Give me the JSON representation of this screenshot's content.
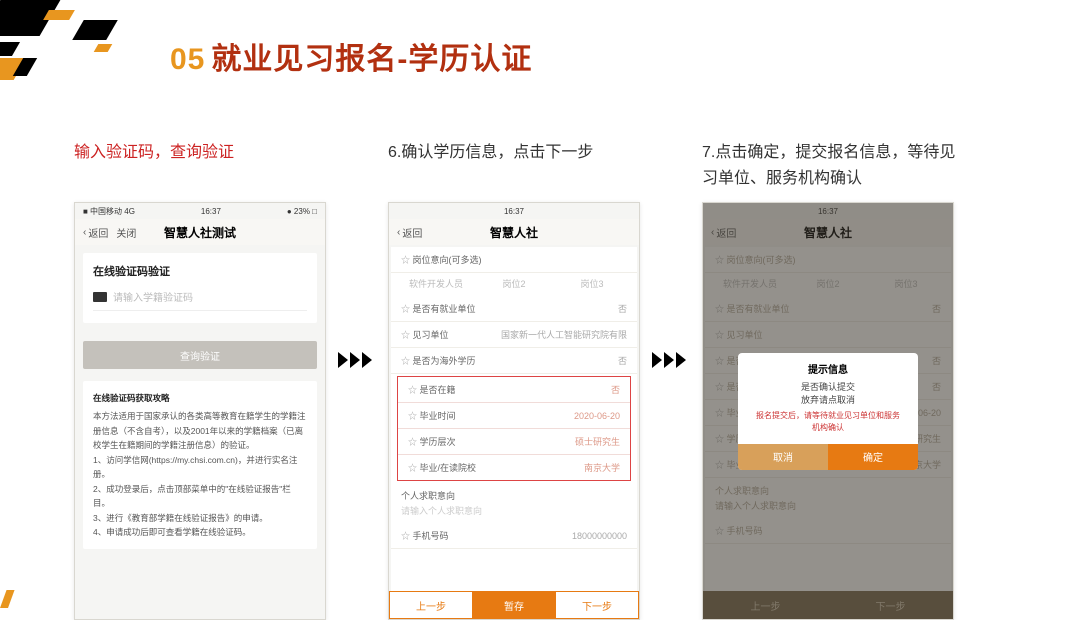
{
  "title": {
    "num": "05",
    "txt": "就业见习报名-学历认证"
  },
  "steps": {
    "s5": "输入验证码，查询验证",
    "s6": "6.确认学历信息，点击下一步",
    "s7": "7.点击确定，提交报名信息，等待见习单位、服务机构确认"
  },
  "phone1": {
    "status_left": "■ 中国移动 4G",
    "time": "16:37",
    "batt": "● 23% □",
    "back": "返回",
    "close": "关闭",
    "nav_title": "智慧人社测试",
    "card_title": "在线验证码验证",
    "placeholder": "请输入学籍验证码",
    "verify_btn": "查询验证",
    "help_title": "在线验证码获取攻略",
    "help_body": "本方法适用于国家承认的各类高等教育在籍学生的学籍注册信息（不含自考），以及2001年以来的学籍档案（已离校学生在籍期间的学籍注册信息）的验证。\n1、访问学信网(https://my.chsi.com.cn)，并进行实名注册。\n2、成功登录后，点击顶部菜单中的\"在线验证报告\"栏目。\n3、进行《教育部学籍在线验证报告》的申请。\n4、申请成功后即可查看学籍在线验证码。"
  },
  "phone2": {
    "time": "16:37",
    "back": "返回",
    "nav_title": "智慧人社",
    "r1": "岗位意向(可多选)",
    "chip1": "软件开发人员",
    "chip2": "岗位2",
    "chip3": "岗位3",
    "r2": "是否有就业单位",
    "v2": "否",
    "r3": "见习单位",
    "v3": "国家新一代人工智能研究院有限",
    "r4": "是否为海外学历",
    "v4": "否",
    "r5": "是否在籍",
    "v5": "否",
    "r6": "毕业时间",
    "v6": "2020-06-20",
    "r7": "学历层次",
    "v7": "硕士研究生",
    "r8": "毕业/在读院校",
    "v8": "南京大学",
    "sect": "个人求职意向",
    "ph": "请输入个人求职意向",
    "r9": "手机号码",
    "v9": "18000000000",
    "prev": "上一步",
    "save": "暂存",
    "next": "下一步"
  },
  "phone3": {
    "time": "16:37",
    "back": "返回",
    "nav_title": "智慧人社",
    "dialog_title": "提示信息",
    "dialog_msg": "是否确认提交\n放弃请点取消",
    "dialog_warn": "报名提交后，请等待就业见习单位和服务机构确认",
    "cancel": "取消",
    "ok": "确定",
    "prev": "上一步",
    "next": "下一步"
  }
}
